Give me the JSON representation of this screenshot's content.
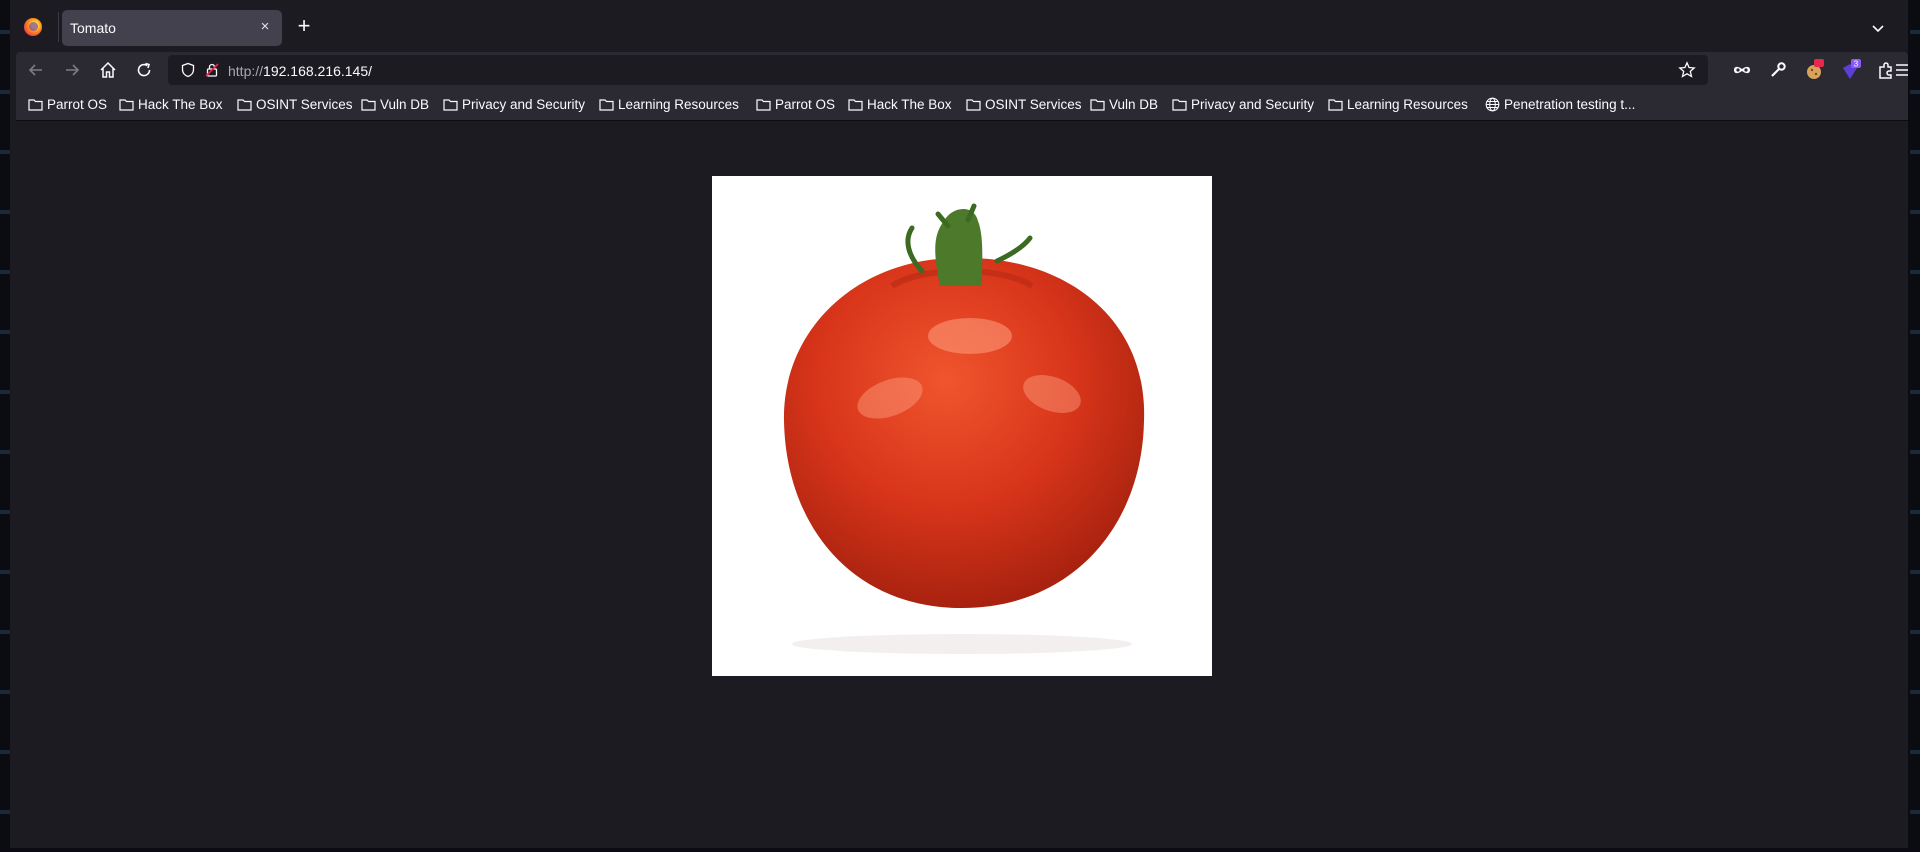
{
  "browser": {
    "tab": {
      "title": "Tomato",
      "close": "×"
    },
    "new_tab": "+",
    "url": {
      "scheme": "http://",
      "host": "192.168.216.145",
      "path": "/"
    },
    "extension_badge": "3"
  },
  "bookmarks": [
    {
      "label": "Parrot OS",
      "icon": "folder-icon"
    },
    {
      "label": "Hack The Box",
      "icon": "folder-icon"
    },
    {
      "label": "OSINT Services",
      "icon": "folder-icon"
    },
    {
      "label": "Vuln DB",
      "icon": "folder-icon"
    },
    {
      "label": "Privacy and Security",
      "icon": "folder-icon"
    },
    {
      "label": "Learning Resources",
      "icon": "folder-icon"
    },
    {
      "label": "Parrot OS",
      "icon": "folder-icon"
    },
    {
      "label": "Hack The Box",
      "icon": "folder-icon"
    },
    {
      "label": "OSINT Services",
      "icon": "folder-icon"
    },
    {
      "label": "Vuln DB",
      "icon": "folder-icon"
    },
    {
      "label": "Privacy and Security",
      "icon": "folder-icon"
    },
    {
      "label": "Learning Resources",
      "icon": "folder-icon"
    },
    {
      "label": "Penetration testing t...",
      "icon": "globe-icon"
    }
  ],
  "page": {
    "image": {
      "subject": "tomato",
      "background": "#ffffff",
      "fill": "#d83a1f"
    }
  },
  "colors": {
    "chrome_bg": "#1c1b22",
    "toolbar_bg": "#2b2a33",
    "active_tab_bg": "#42414d",
    "text": "#fbfbfe"
  }
}
